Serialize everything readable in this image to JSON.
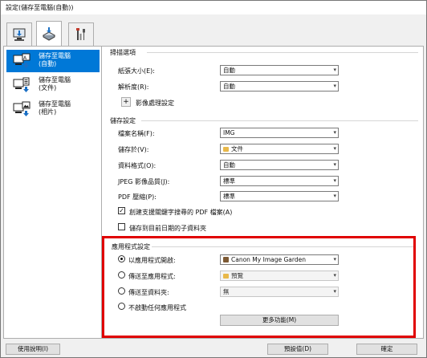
{
  "window": {
    "title": "設定(儲存至電腦(自動))"
  },
  "tabs": [
    {
      "icon": "computer-scan-icon"
    },
    {
      "icon": "scanner-icon"
    },
    {
      "icon": "tools-icon"
    }
  ],
  "sidebar": {
    "items": [
      {
        "label_line1": "儲存至電腦",
        "label_line2": "(自動)",
        "icon": "save-auto-icon",
        "active": true
      },
      {
        "label_line1": "儲存至電腦",
        "label_line2": "(文件)",
        "icon": "save-document-icon",
        "active": false
      },
      {
        "label_line1": "儲存至電腦",
        "label_line2": "(相片)",
        "icon": "save-photo-icon",
        "active": false
      }
    ]
  },
  "scan_options": {
    "title": "掃描選項",
    "paper_size_label": "紙張大小(E):",
    "paper_size_value": "自動",
    "resolution_label": "解析度(R):",
    "resolution_value": "自動",
    "image_processing_label": "影像處理設定"
  },
  "save_settings": {
    "title": "儲存設定",
    "file_name_label": "檔案名稱(F):",
    "file_name_value": "IMG",
    "save_in_label": "儲存於(V):",
    "save_in_value": "文件",
    "data_format_label": "資料格式(O):",
    "data_format_value": "自動",
    "jpeg_quality_label": "JPEG 影像品質(J):",
    "jpeg_quality_value": "標準",
    "pdf_compression_label": "PDF 壓縮(P):",
    "pdf_compression_value": "標準",
    "searchable_pdf_label": "創建支援關鍵字搜尋的 PDF 檔案(A)",
    "searchable_pdf_checked": true,
    "date_subfolder_label": "儲存到目前日期的子資料夾",
    "date_subfolder_checked": false
  },
  "app_settings": {
    "title": "應用程式設定",
    "open_with_label": "以應用程式開啟:",
    "open_with_value": "Canon My Image Garden",
    "send_to_app_label": "傳送至應用程式:",
    "send_to_app_value": "預覽",
    "send_to_folder_label": "傳送至資料夾:",
    "send_to_folder_value": "無",
    "do_not_start_label": "不啟動任何應用程式",
    "selected": "open_with",
    "more_functions_label": "更多功能(M)"
  },
  "footer": {
    "help_label": "使用說明(I)",
    "defaults_label": "預設值(D)",
    "ok_label": "確定"
  },
  "colors": {
    "accent": "#0078d7",
    "highlight_border": "#e00000"
  }
}
